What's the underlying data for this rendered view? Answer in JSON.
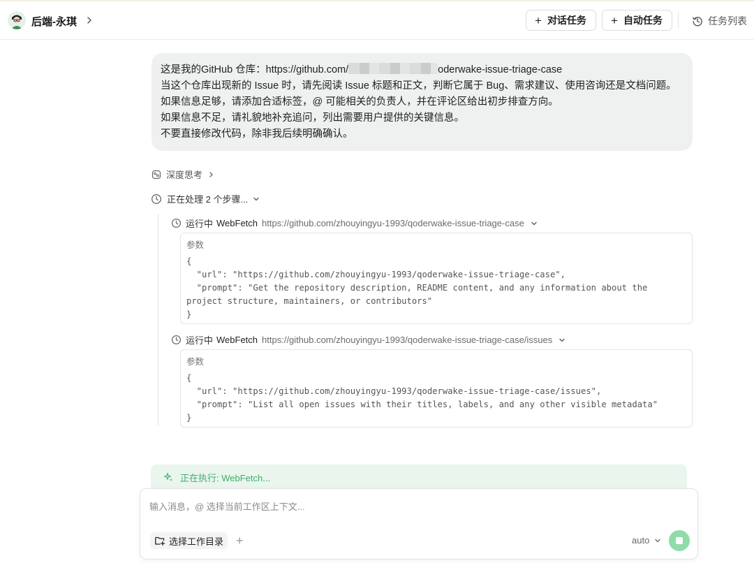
{
  "header": {
    "title": "后端-永琪",
    "chat_task_label": "对话任务",
    "auto_task_label": "自动任务",
    "task_list_label": "任务列表"
  },
  "message": {
    "line1_prefix": "这是我的GitHub 仓库：https://github.com/",
    "line1_suffix": "oderwake-issue-triage-case",
    "line2": "当这个仓库出现新的 Issue 时，请先阅读 Issue 标题和正文，判断它属于 Bug、需求建议、使用咨询还是文档问题。",
    "line3": "如果信息足够，请添加合适标签，@ 可能相关的负责人，并在评论区给出初步排查方向。",
    "line4": "如果信息不足，请礼貌地补充追问，列出需要用户提供的关键信息。",
    "line5": "不要直接修改代码，除非我后续明确确认。"
  },
  "thinking_label": "深度思考",
  "processing_label": "正在处理 2 个步骤...",
  "tools": [
    {
      "status": "运行中",
      "name": "WebFetch",
      "url": "https://github.com/zhouyingyu-1993/qoderwake-issue-triage-case",
      "params_label": "参数",
      "params_text": "{\n  \"url\": \"https://github.com/zhouyingyu-1993/qoderwake-issue-triage-case\",\n  \"prompt\": \"Get the repository description, README content, and any information about the\nproject structure, maintainers, or contributors\"\n}"
    },
    {
      "status": "运行中",
      "name": "WebFetch",
      "url": "https://github.com/zhouyingyu-1993/qoderwake-issue-triage-case/issues",
      "params_label": "参数",
      "params_text": "{\n  \"url\": \"https://github.com/zhouyingyu-1993/qoderwake-issue-triage-case/issues\",\n  \"prompt\": \"List all open issues with their titles, labels, and any other visible metadata\"\n}"
    }
  ],
  "executing_label": "正在执行: WebFetch...",
  "composer": {
    "placeholder": "输入消息，@ 选择当前工作区上下文...",
    "workspace_label": "选择工作目录",
    "model_label": "auto"
  },
  "colors": {
    "accent_green": "#3fae6a",
    "stop_button": "#8fdcaa",
    "bubble_bg": "#eef1ef"
  }
}
